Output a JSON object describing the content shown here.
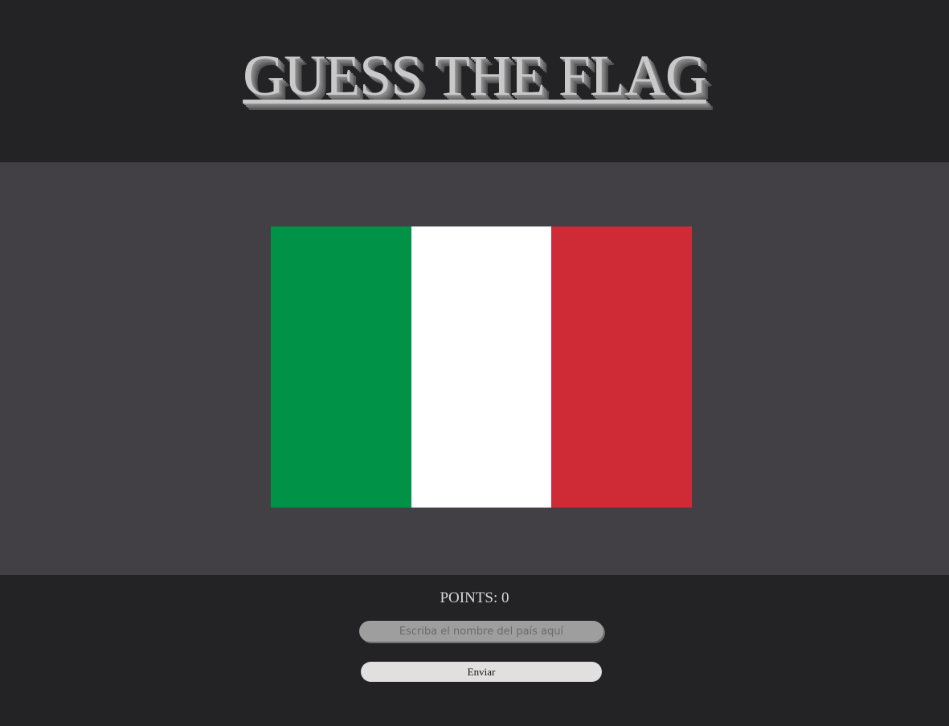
{
  "header": {
    "title": "GUESS THE FLAG"
  },
  "flag": {
    "country_hint_colors": [
      "#009246",
      "#ffffff",
      "#ce2b37"
    ]
  },
  "score": {
    "label": "POINTS:",
    "value": "0"
  },
  "guess": {
    "placeholder": "Escriba el nombre del país aquí",
    "value": ""
  },
  "submit": {
    "label": "Enviar"
  }
}
